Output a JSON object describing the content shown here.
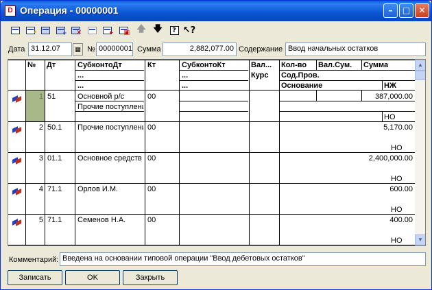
{
  "window": {
    "title": "Операция - 00000001",
    "icon_letter": "D"
  },
  "toolbar": {
    "icons": [
      "new-row-icon",
      "insert-row-icon",
      "edit-icon",
      "copy-row-icon",
      "delete-row-icon",
      "group-icon",
      "move-icon",
      "select-icon",
      "move-up-icon",
      "move-down-icon",
      "help-icon",
      "context-help-icon"
    ]
  },
  "header": {
    "date_label": "Дата",
    "date_value": "31.12.07",
    "number_label": "№",
    "number_value": "00000001",
    "sum_label": "Сумма",
    "sum_value": "2,882,077.00",
    "content_label": "Содержание",
    "content_value": "Ввод начальных остатков"
  },
  "grid": {
    "headers": {
      "num": "№",
      "dt": "Дт",
      "subkonto_dt": "СубконтоДт",
      "subkonto_dt_2": "...",
      "subkonto_dt_3": "...",
      "kt": "Кт",
      "subkonto_kt": "СубконтоКт",
      "subkonto_kt_2": "...",
      "subkonto_kt_3": "...",
      "val": "Вал...",
      "kurs": "Курс",
      "kol": "Кол-во",
      "valsum": "Вал.Сум.",
      "summa": "Сумма",
      "sodprov": "Сод.Пров.",
      "osnovanie": "Основание",
      "nzh": "НЖ"
    },
    "rows": [
      {
        "num": "1",
        "dt": "51",
        "sub1": "Основной р/с",
        "sub2": "Прочие поступлени",
        "kt": "00",
        "summa": "387,000.00",
        "nzh": "НО"
      },
      {
        "num": "2",
        "dt": "50.1",
        "sub1": "Прочие поступлени",
        "sub2": "",
        "kt": "00",
        "summa": "5,170.00",
        "nzh": "НО"
      },
      {
        "num": "3",
        "dt": "01.1",
        "sub1": "Основное средств",
        "sub2": "",
        "kt": "00",
        "summa": "2,400,000.00",
        "nzh": "НО"
      },
      {
        "num": "4",
        "dt": "71.1",
        "sub1": "Орлов И.М.",
        "sub2": "",
        "kt": "00",
        "summa": "600.00",
        "nzh": "НО"
      },
      {
        "num": "5",
        "dt": "71.1",
        "sub1": "Семенов Н.А.",
        "sub2": "",
        "kt": "00",
        "summa": "400.00",
        "nzh": "НО"
      }
    ]
  },
  "footer": {
    "comment_label": "Комментарий:",
    "comment_value": "Введена на основании типовой операции \"Ввод дебетовых остатков\"",
    "save_label": "Записать",
    "ok_label": "OK",
    "close_label": "Закрыть"
  }
}
